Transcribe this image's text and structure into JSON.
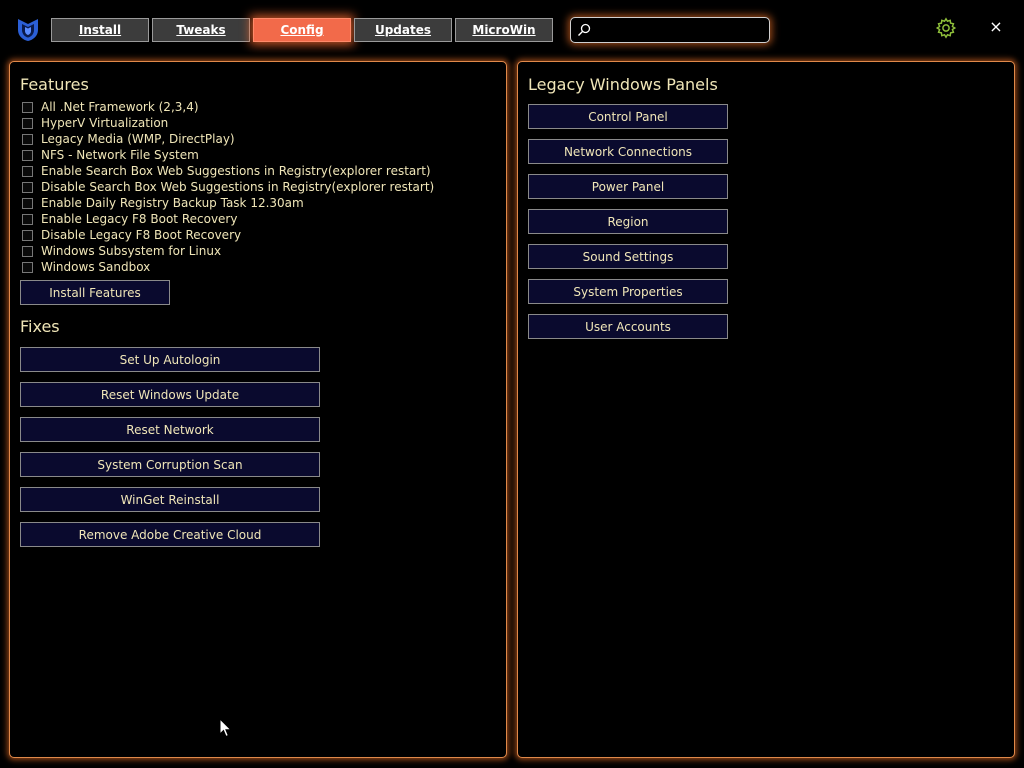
{
  "header": {
    "tabs": [
      {
        "label": "Install"
      },
      {
        "label": "Tweaks"
      },
      {
        "label": "Config"
      },
      {
        "label": "Updates"
      },
      {
        "label": "MicroWin"
      }
    ],
    "active_tab": "Config",
    "search": {
      "value": "",
      "placeholder": ""
    },
    "close_label": "×",
    "icons": {
      "logo": "winutil-logo-icon",
      "search": "search-icon",
      "settings": "gear-icon",
      "close": "close-icon"
    }
  },
  "features": {
    "title": "Features",
    "items": [
      {
        "label": "All .Net Framework (2,3,4)",
        "checked": false
      },
      {
        "label": "HyperV Virtualization",
        "checked": false
      },
      {
        "label": "Legacy Media (WMP, DirectPlay)",
        "checked": false
      },
      {
        "label": "NFS - Network File System",
        "checked": false
      },
      {
        "label": "Enable Search Box Web Suggestions in Registry(explorer restart)",
        "checked": false
      },
      {
        "label": "Disable Search Box Web Suggestions in Registry(explorer restart)",
        "checked": false
      },
      {
        "label": "Enable Daily Registry Backup Task 12.30am",
        "checked": false
      },
      {
        "label": "Enable Legacy F8 Boot Recovery",
        "checked": false
      },
      {
        "label": "Disable Legacy F8 Boot Recovery",
        "checked": false
      },
      {
        "label": "Windows Subsystem for Linux",
        "checked": false
      },
      {
        "label": "Windows Sandbox",
        "checked": false
      }
    ],
    "install_button": "Install Features"
  },
  "fixes": {
    "title": "Fixes",
    "buttons": [
      "Set Up Autologin",
      "Reset Windows Update",
      "Reset Network",
      "System Corruption Scan",
      "WinGet Reinstall",
      "Remove Adobe Creative Cloud"
    ]
  },
  "legacy_panels": {
    "title": "Legacy Windows Panels",
    "buttons": [
      "Control Panel",
      "Network Connections",
      "Power Panel",
      "Region",
      "Sound Settings",
      "System Properties",
      "User Accounts"
    ]
  },
  "colors": {
    "accent": "#f26a4a",
    "panel_border": "#e0894a",
    "text": "#f0e6b8",
    "button_bg": "#0a0a2e"
  }
}
